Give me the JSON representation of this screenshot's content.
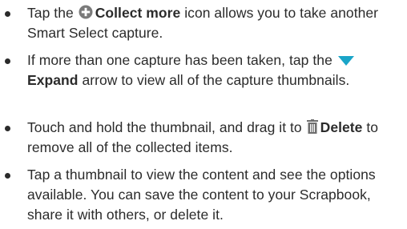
{
  "bullets": [
    {
      "pre": "Tap the",
      "icon": "plus-circle-icon",
      "bold": "Collect more",
      "post": "icon allows you to take another Smart Select capture."
    },
    {
      "pre": "If more than one capture has been taken, tap the",
      "icon": "expand-arrow-icon",
      "bold": "Expand",
      "post": "arrow to view all of the capture thumbnails."
    },
    {
      "pre": "Touch and hold the thumbnail, and drag it to",
      "icon": "trash-icon",
      "bold": "Delete",
      "post": "to remove all of the collected items."
    },
    {
      "text": "Tap a thumbnail to view the content and see the options available. You can save the content to your Scrapbook, share it with others, or delete it."
    }
  ],
  "colors": {
    "text": "#2b2b2b",
    "plus_icon": "#7a7a7a",
    "expand_icon": "#1aa5c8",
    "trash_icon": "#6e6e6e"
  }
}
